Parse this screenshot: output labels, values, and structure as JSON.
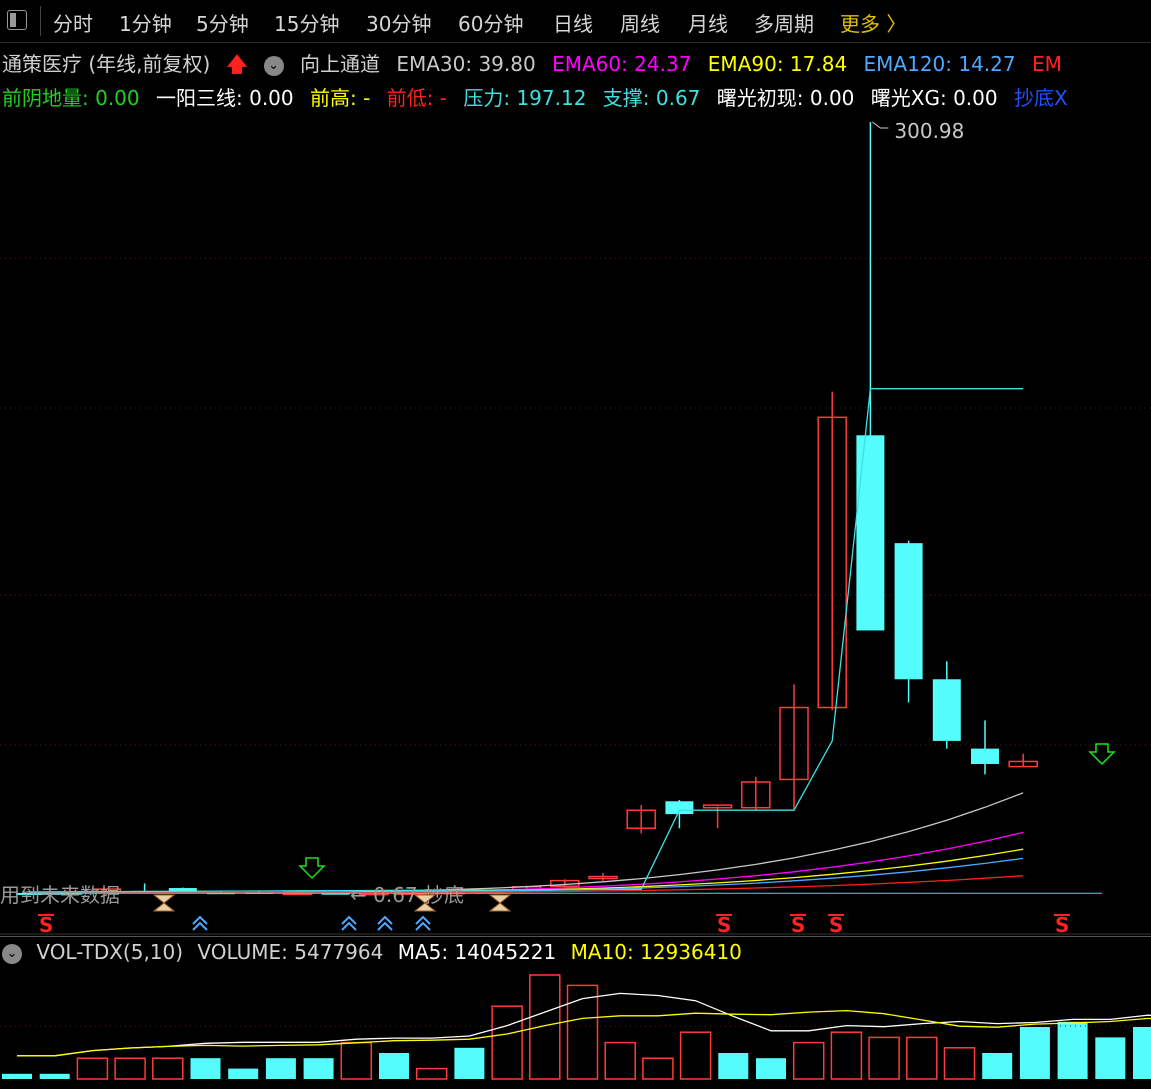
{
  "toolbar": {
    "tabs": [
      "分时",
      "1分钟",
      "5分钟",
      "15分钟",
      "30分钟",
      "60分钟",
      "日线",
      "周线",
      "月线",
      "多周期"
    ],
    "more_label": "更多 〉"
  },
  "header": {
    "stock": "通策医疗 (年线,前复权)",
    "signal_label": "向上通道",
    "ema": [
      {
        "label": "EMA30: 39.80",
        "color": "#c8c8c8"
      },
      {
        "label": "EMA60: 24.37",
        "color": "#ff00ff"
      },
      {
        "label": "EMA90: 17.84",
        "color": "#ffff00"
      },
      {
        "label": "EMA120: 14.27",
        "color": "#4fa8ff"
      },
      {
        "label": "EM",
        "color": "#ff2020"
      }
    ],
    "indicators": [
      {
        "label": "前阴地量: 0.00",
        "color": "#20d020"
      },
      {
        "label": "一阳三线: 0.00",
        "color": "#ffffff"
      },
      {
        "label": "前高: -",
        "color": "#ffff00"
      },
      {
        "label": "前低: -",
        "color": "#ff2020"
      },
      {
        "label": "压力: 197.12",
        "color": "#40e0e0"
      },
      {
        "label": "支撑: 0.67",
        "color": "#40e0e0"
      },
      {
        "label": "曙光初现: 0.00",
        "color": "#ffffff"
      },
      {
        "label": "曙光XG: 0.00",
        "color": "#ffffff"
      },
      {
        "label": "抄底X",
        "color": "#2050ff"
      }
    ]
  },
  "chart_data": {
    "type": "candlestick",
    "price_axis_max_label": "300.98",
    "overlay_text_left": "用到未来数据",
    "overlay_text_mid": "← 0.67 抄底",
    "candles": [
      {
        "o": 0.8,
        "h": 1.0,
        "l": 0.6,
        "c": 0.7,
        "dir": "down"
      },
      {
        "o": 0.9,
        "h": 1.0,
        "l": 0.7,
        "c": 0.8,
        "dir": "down"
      },
      {
        "o": 0.9,
        "h": 2.5,
        "l": 0.8,
        "c": 2.3,
        "dir": "up"
      },
      {
        "o": 1.6,
        "h": 4.5,
        "l": 1.0,
        "c": 1.2,
        "dir": "down"
      },
      {
        "o": 1.2,
        "h": 2.9,
        "l": 0.9,
        "c": 2.7,
        "dir": "down"
      },
      {
        "o": 1.0,
        "h": 1.6,
        "l": 0.8,
        "c": 1.1,
        "dir": "down"
      },
      {
        "o": 1.0,
        "h": 1.5,
        "l": 0.8,
        "c": 1.2,
        "dir": "down"
      },
      {
        "o": 0.8,
        "h": 1.2,
        "l": 0.6,
        "c": 1.0,
        "dir": "up"
      },
      {
        "o": 0.9,
        "h": 1.0,
        "l": 0.7,
        "c": 0.8,
        "dir": "down"
      },
      {
        "o": 0.7,
        "h": 1.0,
        "l": 0.6,
        "c": 0.9,
        "dir": "up"
      },
      {
        "o": 1.1,
        "h": 1.2,
        "l": 0.9,
        "c": 1.0,
        "dir": "up"
      },
      {
        "o": 1.2,
        "h": 1.5,
        "l": 1.0,
        "c": 1.3,
        "dir": "up"
      },
      {
        "o": 1.2,
        "h": 1.9,
        "l": 1.0,
        "c": 1.6,
        "dir": "up"
      },
      {
        "o": 1.9,
        "h": 3.7,
        "l": 1.7,
        "c": 3.2,
        "dir": "up"
      },
      {
        "o": 3.4,
        "h": 6.1,
        "l": 3.0,
        "c": 5.6,
        "dir": "up"
      },
      {
        "o": 7.2,
        "h": 8.6,
        "l": 5.5,
        "c": 6.5,
        "dir": "up"
      },
      {
        "o": 26.0,
        "h": 35.0,
        "l": 24.0,
        "c": 33.0,
        "dir": "up"
      },
      {
        "o": 36.5,
        "h": 37.0,
        "l": 26.0,
        "c": 31.5,
        "dir": "down"
      },
      {
        "o": 34.0,
        "h": 34.5,
        "l": 26.0,
        "c": 35.0,
        "dir": "flat"
      },
      {
        "o": 34.0,
        "h": 46.0,
        "l": 33.0,
        "c": 44.0,
        "dir": "up"
      },
      {
        "o": 45.0,
        "h": 82.0,
        "l": 33.0,
        "c": 73.0,
        "dir": "up"
      },
      {
        "o": 73.0,
        "h": 196.0,
        "l": 72.0,
        "c": 186.0,
        "dir": "up"
      },
      {
        "o": 179.0,
        "h": 300.98,
        "l": 110.0,
        "c": 103.0,
        "dir": "down"
      },
      {
        "o": 137.0,
        "h": 138.0,
        "l": 75.0,
        "c": 84.0,
        "dir": "down"
      },
      {
        "o": 84.0,
        "h": 91.0,
        "l": 57.0,
        "c": 60.0,
        "dir": "down"
      },
      {
        "o": 57.0,
        "h": 68.0,
        "l": 47.0,
        "c": 51.0,
        "dir": "down"
      },
      {
        "o": 50.0,
        "h": 55.0,
        "l": 50.0,
        "c": 52.0,
        "dir": "flat"
      }
    ],
    "volume": {
      "values": [
        0.05,
        0.05,
        0.2,
        0.2,
        0.2,
        0.2,
        0.1,
        0.2,
        0.2,
        0.35,
        0.25,
        0.1,
        0.3,
        0.7,
        1.0,
        0.9,
        0.35,
        0.2,
        0.45,
        0.25,
        0.2,
        0.35,
        0.45,
        0.4,
        0.4,
        0.3,
        0.25,
        0.5,
        0.55,
        0.4,
        0.5,
        0.15
      ],
      "dir": [
        "down",
        "down",
        "up",
        "up",
        "up",
        "down",
        "down",
        "down",
        "down",
        "up",
        "down",
        "up",
        "down",
        "up",
        "up",
        "up",
        "up",
        "up",
        "up",
        "down",
        "down",
        "up",
        "up",
        "up",
        "up",
        "up",
        "down",
        "down",
        "down",
        "down",
        "down",
        "down"
      ]
    }
  },
  "volume_header": {
    "name": "VOL-TDX(5,10)",
    "volume": "VOLUME: 5477964",
    "ma5": "MA5: 14045221",
    "ma10": "MA10: 12936410"
  },
  "colors": {
    "up": "#ff3b3b",
    "down": "#54fcfc",
    "ema30": "#c8c8c8",
    "ema60": "#ff00ff",
    "ema90": "#ffff00",
    "ema120": "#4fa8ff",
    "ema250": "#ff2020",
    "channel": "#40e0e0"
  }
}
